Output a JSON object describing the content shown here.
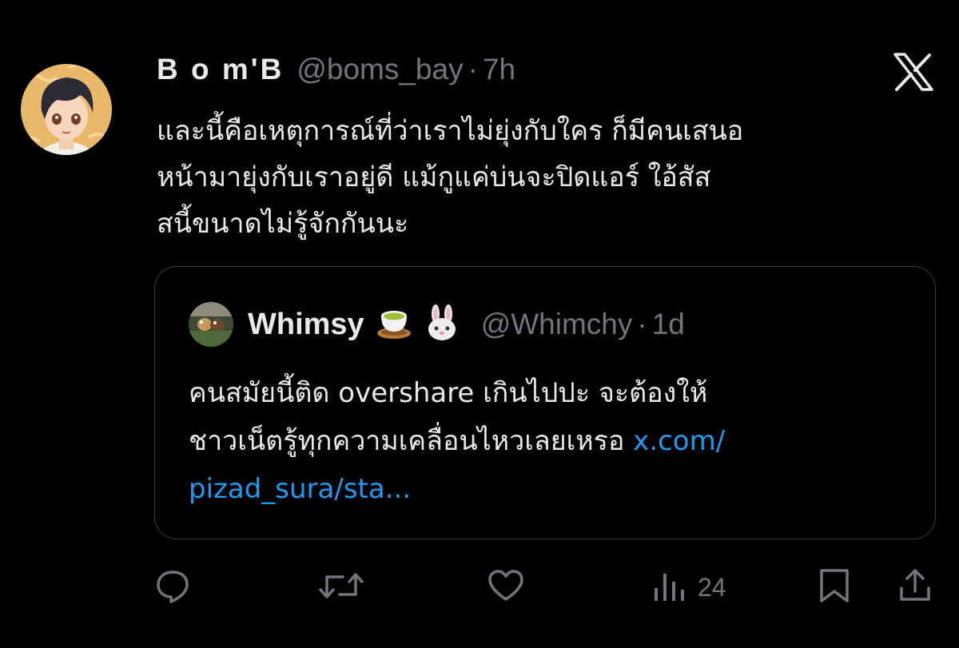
{
  "tweet": {
    "display_name": "B o m'B",
    "handle": "@boms_bay",
    "separator": "·",
    "time": "7h",
    "text_lines": [
      "และนี้คือเหตุการณ์ที่ว่าเราไม่ยุ่งกับใคร ก็มีคนเสนอ",
      "หน้ามายุ่งกับเราอยู่ดี แม้กูแค่บ่นจะปิดแอร์ ใอ้สัส",
      "สนี้ขนาดไม่รู้จักกันนะ"
    ]
  },
  "quote": {
    "display_name": "Whimsy",
    "emojis": [
      "tea-cup-icon",
      "rabbit-face-icon"
    ],
    "handle": "@Whimchy",
    "separator": "·",
    "time": "1d",
    "line1": "คนสมัยนี้ติด overshare เกินไปปะ จะต้องให้",
    "line2": "ชาวเน็ตรู้ทุกความเคลื่อนไหวเลยเหรอ ",
    "link_part1": "x.com/",
    "link_part2": "pizad_sura/sta..."
  },
  "actions": {
    "views_count": "24",
    "icons": [
      "reply-icon",
      "retweet-icon",
      "like-icon",
      "views-icon",
      "bookmark-icon",
      "share-icon"
    ]
  },
  "colors": {
    "background": "#000000",
    "text": "#e7e9ea",
    "muted": "#71767b",
    "link": "#1d9bf0",
    "border": "#3a3d40"
  }
}
